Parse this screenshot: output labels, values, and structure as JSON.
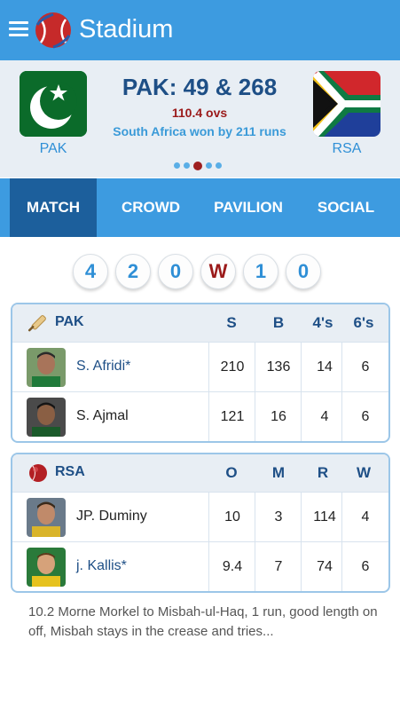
{
  "app": {
    "title": "Stadium"
  },
  "match": {
    "team1": {
      "code": "PAK"
    },
    "team2": {
      "code": "RSA"
    },
    "score": "PAK: 49 & 268",
    "overs": "110.4 ovs",
    "result": "South Africa won by 211 runs",
    "page_index": 3,
    "page_count": 5
  },
  "tabs": [
    {
      "label": "MATCH",
      "active": true
    },
    {
      "label": "CROWD",
      "active": false
    },
    {
      "label": "PAVILION",
      "active": false
    },
    {
      "label": "SOCIAL",
      "active": false
    }
  ],
  "recent_balls": [
    "4",
    "2",
    "0",
    "W",
    "1",
    "0"
  ],
  "batting": {
    "team": "PAK",
    "columns": [
      "S",
      "B",
      "4's",
      "6's"
    ],
    "rows": [
      {
        "name": "S. Afridi*",
        "on_strike": true,
        "values": [
          "210",
          "136",
          "14",
          "6"
        ]
      },
      {
        "name": "S. Ajmal",
        "on_strike": false,
        "values": [
          "121",
          "16",
          "4",
          "6"
        ]
      }
    ]
  },
  "bowling": {
    "team": "RSA",
    "columns": [
      "O",
      "M",
      "R",
      "W"
    ],
    "rows": [
      {
        "name": "JP. Duminy",
        "on_strike": false,
        "values": [
          "10",
          "3",
          "114",
          "4"
        ]
      },
      {
        "name": "j. Kallis*",
        "on_strike": true,
        "values": [
          "9.4",
          "7",
          "74",
          "6"
        ]
      }
    ]
  },
  "commentary": "10.2 Morne Morkel to Misbah-ul-Haq, 1 run, good length on off, Misbah stays in the crease and tries...",
  "colors": {
    "primary": "#3d9be0",
    "tab_active": "#1c5f9c",
    "accent_red": "#9b1a1a",
    "text_navy": "#1e4f86"
  }
}
